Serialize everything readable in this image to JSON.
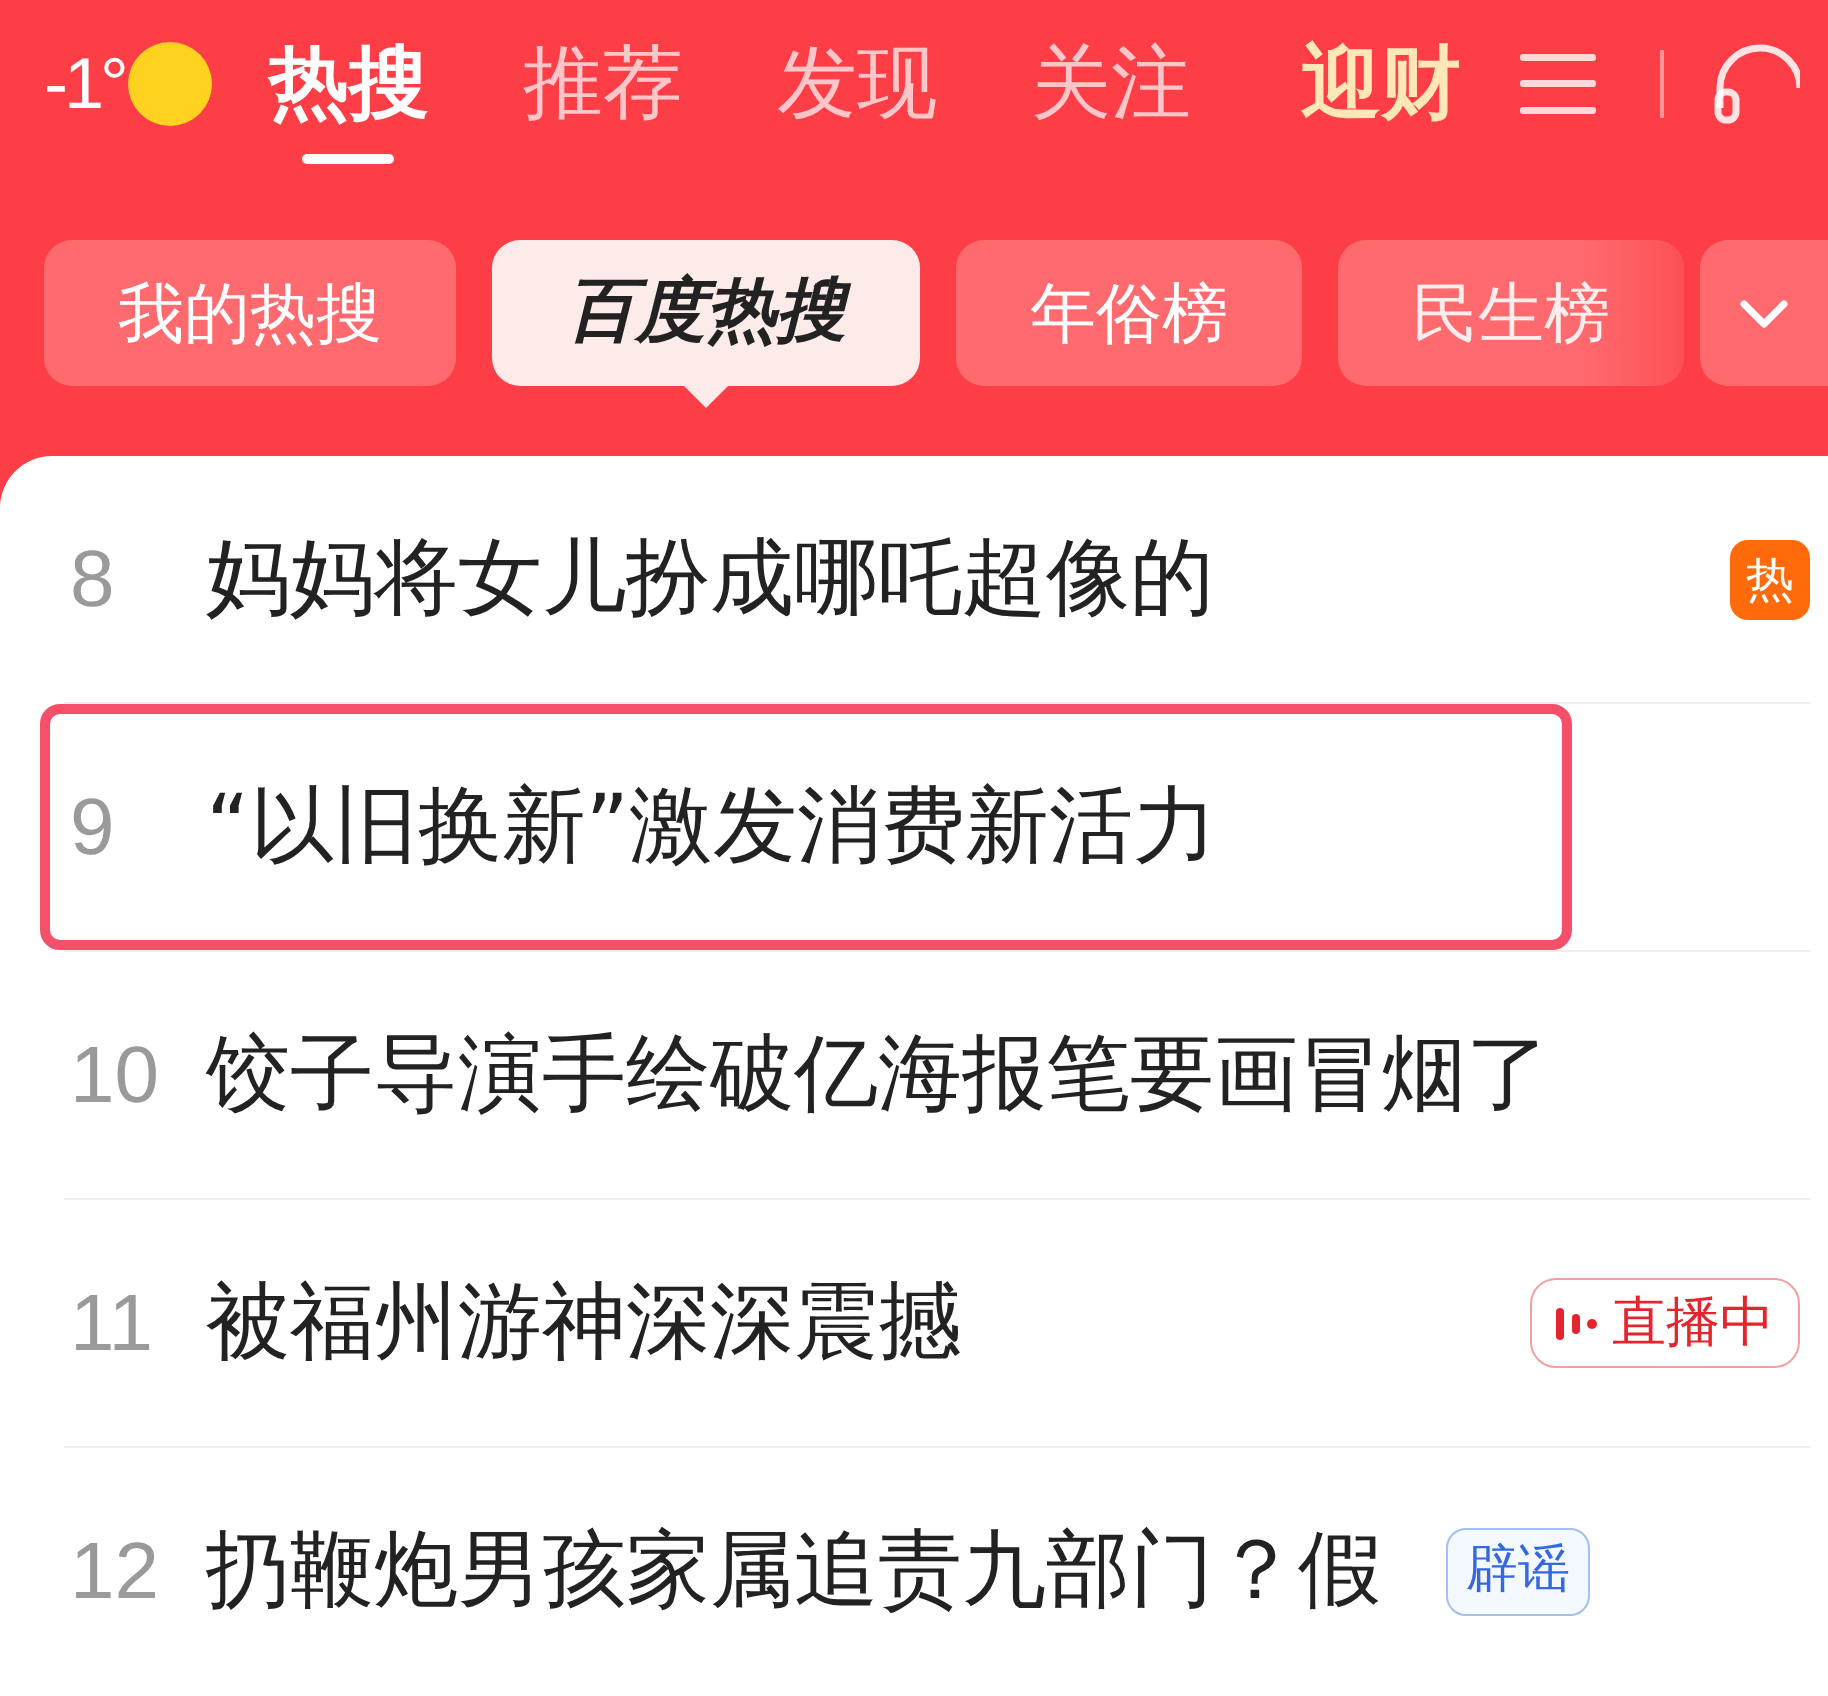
{
  "weather": {
    "temperature": "-1°"
  },
  "tabs": [
    {
      "label": "热搜",
      "selected": true
    },
    {
      "label": "推荐",
      "selected": false
    },
    {
      "label": "发现",
      "selected": false
    },
    {
      "label": "关注",
      "selected": false
    }
  ],
  "promo": {
    "label": "迎财"
  },
  "list_tabs": [
    {
      "label": "我的热搜",
      "selected": false
    },
    {
      "label": "百度热搜",
      "selected": true
    },
    {
      "label": "年俗榜",
      "selected": false
    },
    {
      "label": "民生榜",
      "selected": false
    }
  ],
  "hot_list": [
    {
      "rank": "8",
      "title": "妈妈将女儿扮成哪吒超像的",
      "highlighted": false,
      "badge": {
        "kind": "hot",
        "label": "热"
      }
    },
    {
      "rank": "9",
      "title": "“以旧换新”激发消费新活力",
      "highlighted": true
    },
    {
      "rank": "10",
      "title": "饺子导演手绘破亿海报笔要画冒烟了",
      "highlighted": false
    },
    {
      "rank": "11",
      "title": "被福州游神深深震撼",
      "highlighted": false,
      "badge": {
        "kind": "live",
        "label": "直播中"
      }
    },
    {
      "rank": "12",
      "title": "扔鞭炮男孩家属追责九部门？假",
      "highlighted": false,
      "badge": {
        "kind": "rumor",
        "label": "辟谣"
      }
    }
  ]
}
